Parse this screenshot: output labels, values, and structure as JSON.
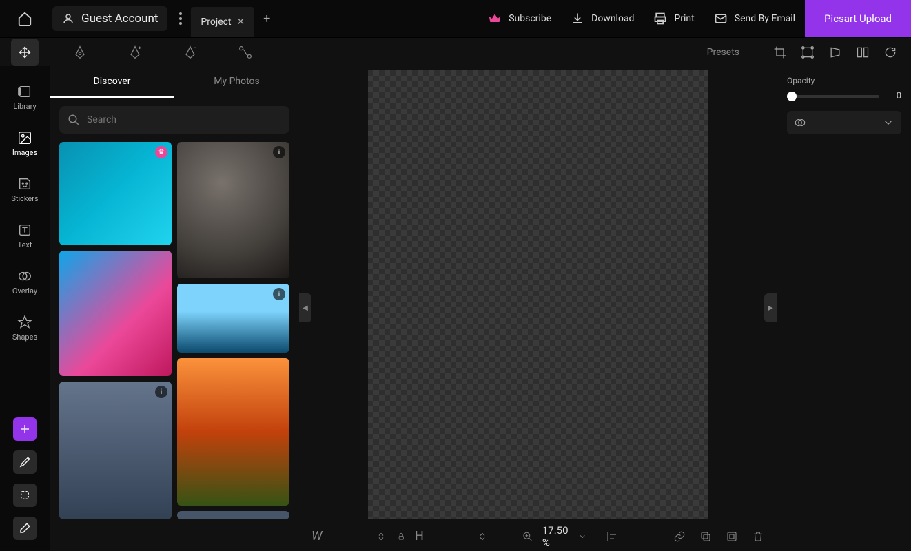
{
  "header": {
    "account_label": "Guest Account",
    "project_tab": "Project",
    "subscribe": "Subscribe",
    "download": "Download",
    "print": "Print",
    "send_email": "Send By Email",
    "upload": "Picsart Upload"
  },
  "toolbar": {
    "presets": "Presets"
  },
  "rail": {
    "library": "Library",
    "images": "Images",
    "stickers": "Stickers",
    "text": "Text",
    "overlay": "Overlay",
    "shapes": "Shapes"
  },
  "panel": {
    "tab_discover": "Discover",
    "tab_my_photos": "My Photos",
    "search_placeholder": "Search"
  },
  "right": {
    "opacity_label": "Opacity",
    "opacity_value": "0"
  },
  "bottom": {
    "w_label": "W",
    "h_label": "H",
    "zoom": "17.50 %"
  }
}
